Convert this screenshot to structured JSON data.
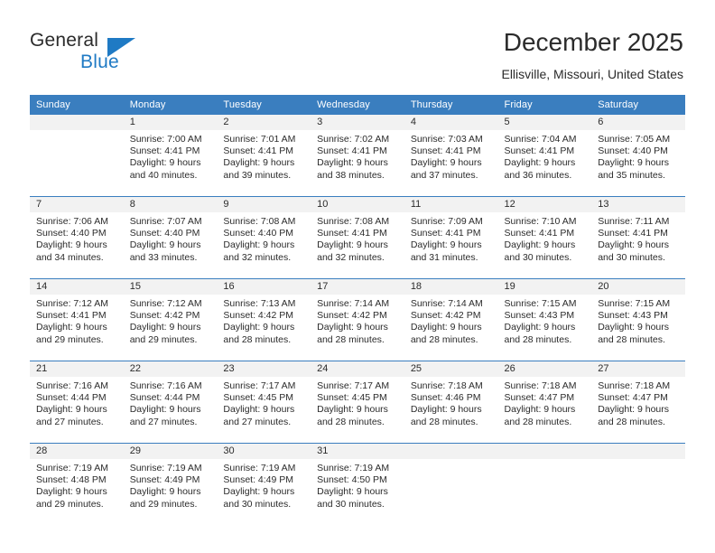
{
  "brand": {
    "name_part1": "General",
    "name_part2": "Blue",
    "triangle_color": "#1f7ac4"
  },
  "header": {
    "title": "December 2025",
    "subtitle": "Ellisville, Missouri, United States"
  },
  "theme": {
    "header_blue": "#3a7ebf",
    "day_band_gray": "#f2f2f2",
    "text_color": "#2b2b2b"
  },
  "weekdays": [
    "Sunday",
    "Monday",
    "Tuesday",
    "Wednesday",
    "Thursday",
    "Friday",
    "Saturday"
  ],
  "weeks": [
    [
      {
        "day": "",
        "sunrise": "",
        "sunset": "",
        "daylight_1": "",
        "daylight_2": "",
        "empty": true
      },
      {
        "day": "1",
        "sunrise": "Sunrise: 7:00 AM",
        "sunset": "Sunset: 4:41 PM",
        "daylight_1": "Daylight: 9 hours",
        "daylight_2": "and 40 minutes."
      },
      {
        "day": "2",
        "sunrise": "Sunrise: 7:01 AM",
        "sunset": "Sunset: 4:41 PM",
        "daylight_1": "Daylight: 9 hours",
        "daylight_2": "and 39 minutes."
      },
      {
        "day": "3",
        "sunrise": "Sunrise: 7:02 AM",
        "sunset": "Sunset: 4:41 PM",
        "daylight_1": "Daylight: 9 hours",
        "daylight_2": "and 38 minutes."
      },
      {
        "day": "4",
        "sunrise": "Sunrise: 7:03 AM",
        "sunset": "Sunset: 4:41 PM",
        "daylight_1": "Daylight: 9 hours",
        "daylight_2": "and 37 minutes."
      },
      {
        "day": "5",
        "sunrise": "Sunrise: 7:04 AM",
        "sunset": "Sunset: 4:41 PM",
        "daylight_1": "Daylight: 9 hours",
        "daylight_2": "and 36 minutes."
      },
      {
        "day": "6",
        "sunrise": "Sunrise: 7:05 AM",
        "sunset": "Sunset: 4:40 PM",
        "daylight_1": "Daylight: 9 hours",
        "daylight_2": "and 35 minutes."
      }
    ],
    [
      {
        "day": "7",
        "sunrise": "Sunrise: 7:06 AM",
        "sunset": "Sunset: 4:40 PM",
        "daylight_1": "Daylight: 9 hours",
        "daylight_2": "and 34 minutes."
      },
      {
        "day": "8",
        "sunrise": "Sunrise: 7:07 AM",
        "sunset": "Sunset: 4:40 PM",
        "daylight_1": "Daylight: 9 hours",
        "daylight_2": "and 33 minutes."
      },
      {
        "day": "9",
        "sunrise": "Sunrise: 7:08 AM",
        "sunset": "Sunset: 4:40 PM",
        "daylight_1": "Daylight: 9 hours",
        "daylight_2": "and 32 minutes."
      },
      {
        "day": "10",
        "sunrise": "Sunrise: 7:08 AM",
        "sunset": "Sunset: 4:41 PM",
        "daylight_1": "Daylight: 9 hours",
        "daylight_2": "and 32 minutes."
      },
      {
        "day": "11",
        "sunrise": "Sunrise: 7:09 AM",
        "sunset": "Sunset: 4:41 PM",
        "daylight_1": "Daylight: 9 hours",
        "daylight_2": "and 31 minutes."
      },
      {
        "day": "12",
        "sunrise": "Sunrise: 7:10 AM",
        "sunset": "Sunset: 4:41 PM",
        "daylight_1": "Daylight: 9 hours",
        "daylight_2": "and 30 minutes."
      },
      {
        "day": "13",
        "sunrise": "Sunrise: 7:11 AM",
        "sunset": "Sunset: 4:41 PM",
        "daylight_1": "Daylight: 9 hours",
        "daylight_2": "and 30 minutes."
      }
    ],
    [
      {
        "day": "14",
        "sunrise": "Sunrise: 7:12 AM",
        "sunset": "Sunset: 4:41 PM",
        "daylight_1": "Daylight: 9 hours",
        "daylight_2": "and 29 minutes."
      },
      {
        "day": "15",
        "sunrise": "Sunrise: 7:12 AM",
        "sunset": "Sunset: 4:42 PM",
        "daylight_1": "Daylight: 9 hours",
        "daylight_2": "and 29 minutes."
      },
      {
        "day": "16",
        "sunrise": "Sunrise: 7:13 AM",
        "sunset": "Sunset: 4:42 PM",
        "daylight_1": "Daylight: 9 hours",
        "daylight_2": "and 28 minutes."
      },
      {
        "day": "17",
        "sunrise": "Sunrise: 7:14 AM",
        "sunset": "Sunset: 4:42 PM",
        "daylight_1": "Daylight: 9 hours",
        "daylight_2": "and 28 minutes."
      },
      {
        "day": "18",
        "sunrise": "Sunrise: 7:14 AM",
        "sunset": "Sunset: 4:42 PM",
        "daylight_1": "Daylight: 9 hours",
        "daylight_2": "and 28 minutes."
      },
      {
        "day": "19",
        "sunrise": "Sunrise: 7:15 AM",
        "sunset": "Sunset: 4:43 PM",
        "daylight_1": "Daylight: 9 hours",
        "daylight_2": "and 28 minutes."
      },
      {
        "day": "20",
        "sunrise": "Sunrise: 7:15 AM",
        "sunset": "Sunset: 4:43 PM",
        "daylight_1": "Daylight: 9 hours",
        "daylight_2": "and 28 minutes."
      }
    ],
    [
      {
        "day": "21",
        "sunrise": "Sunrise: 7:16 AM",
        "sunset": "Sunset: 4:44 PM",
        "daylight_1": "Daylight: 9 hours",
        "daylight_2": "and 27 minutes."
      },
      {
        "day": "22",
        "sunrise": "Sunrise: 7:16 AM",
        "sunset": "Sunset: 4:44 PM",
        "daylight_1": "Daylight: 9 hours",
        "daylight_2": "and 27 minutes."
      },
      {
        "day": "23",
        "sunrise": "Sunrise: 7:17 AM",
        "sunset": "Sunset: 4:45 PM",
        "daylight_1": "Daylight: 9 hours",
        "daylight_2": "and 27 minutes."
      },
      {
        "day": "24",
        "sunrise": "Sunrise: 7:17 AM",
        "sunset": "Sunset: 4:45 PM",
        "daylight_1": "Daylight: 9 hours",
        "daylight_2": "and 28 minutes."
      },
      {
        "day": "25",
        "sunrise": "Sunrise: 7:18 AM",
        "sunset": "Sunset: 4:46 PM",
        "daylight_1": "Daylight: 9 hours",
        "daylight_2": "and 28 minutes."
      },
      {
        "day": "26",
        "sunrise": "Sunrise: 7:18 AM",
        "sunset": "Sunset: 4:47 PM",
        "daylight_1": "Daylight: 9 hours",
        "daylight_2": "and 28 minutes."
      },
      {
        "day": "27",
        "sunrise": "Sunrise: 7:18 AM",
        "sunset": "Sunset: 4:47 PM",
        "daylight_1": "Daylight: 9 hours",
        "daylight_2": "and 28 minutes."
      }
    ],
    [
      {
        "day": "28",
        "sunrise": "Sunrise: 7:19 AM",
        "sunset": "Sunset: 4:48 PM",
        "daylight_1": "Daylight: 9 hours",
        "daylight_2": "and 29 minutes."
      },
      {
        "day": "29",
        "sunrise": "Sunrise: 7:19 AM",
        "sunset": "Sunset: 4:49 PM",
        "daylight_1": "Daylight: 9 hours",
        "daylight_2": "and 29 minutes."
      },
      {
        "day": "30",
        "sunrise": "Sunrise: 7:19 AM",
        "sunset": "Sunset: 4:49 PM",
        "daylight_1": "Daylight: 9 hours",
        "daylight_2": "and 30 minutes."
      },
      {
        "day": "31",
        "sunrise": "Sunrise: 7:19 AM",
        "sunset": "Sunset: 4:50 PM",
        "daylight_1": "Daylight: 9 hours",
        "daylight_2": "and 30 minutes."
      },
      {
        "day": "",
        "sunrise": "",
        "sunset": "",
        "daylight_1": "",
        "daylight_2": "",
        "empty": true
      },
      {
        "day": "",
        "sunrise": "",
        "sunset": "",
        "daylight_1": "",
        "daylight_2": "",
        "empty": true
      },
      {
        "day": "",
        "sunrise": "",
        "sunset": "",
        "daylight_1": "",
        "daylight_2": "",
        "empty": true
      }
    ]
  ]
}
